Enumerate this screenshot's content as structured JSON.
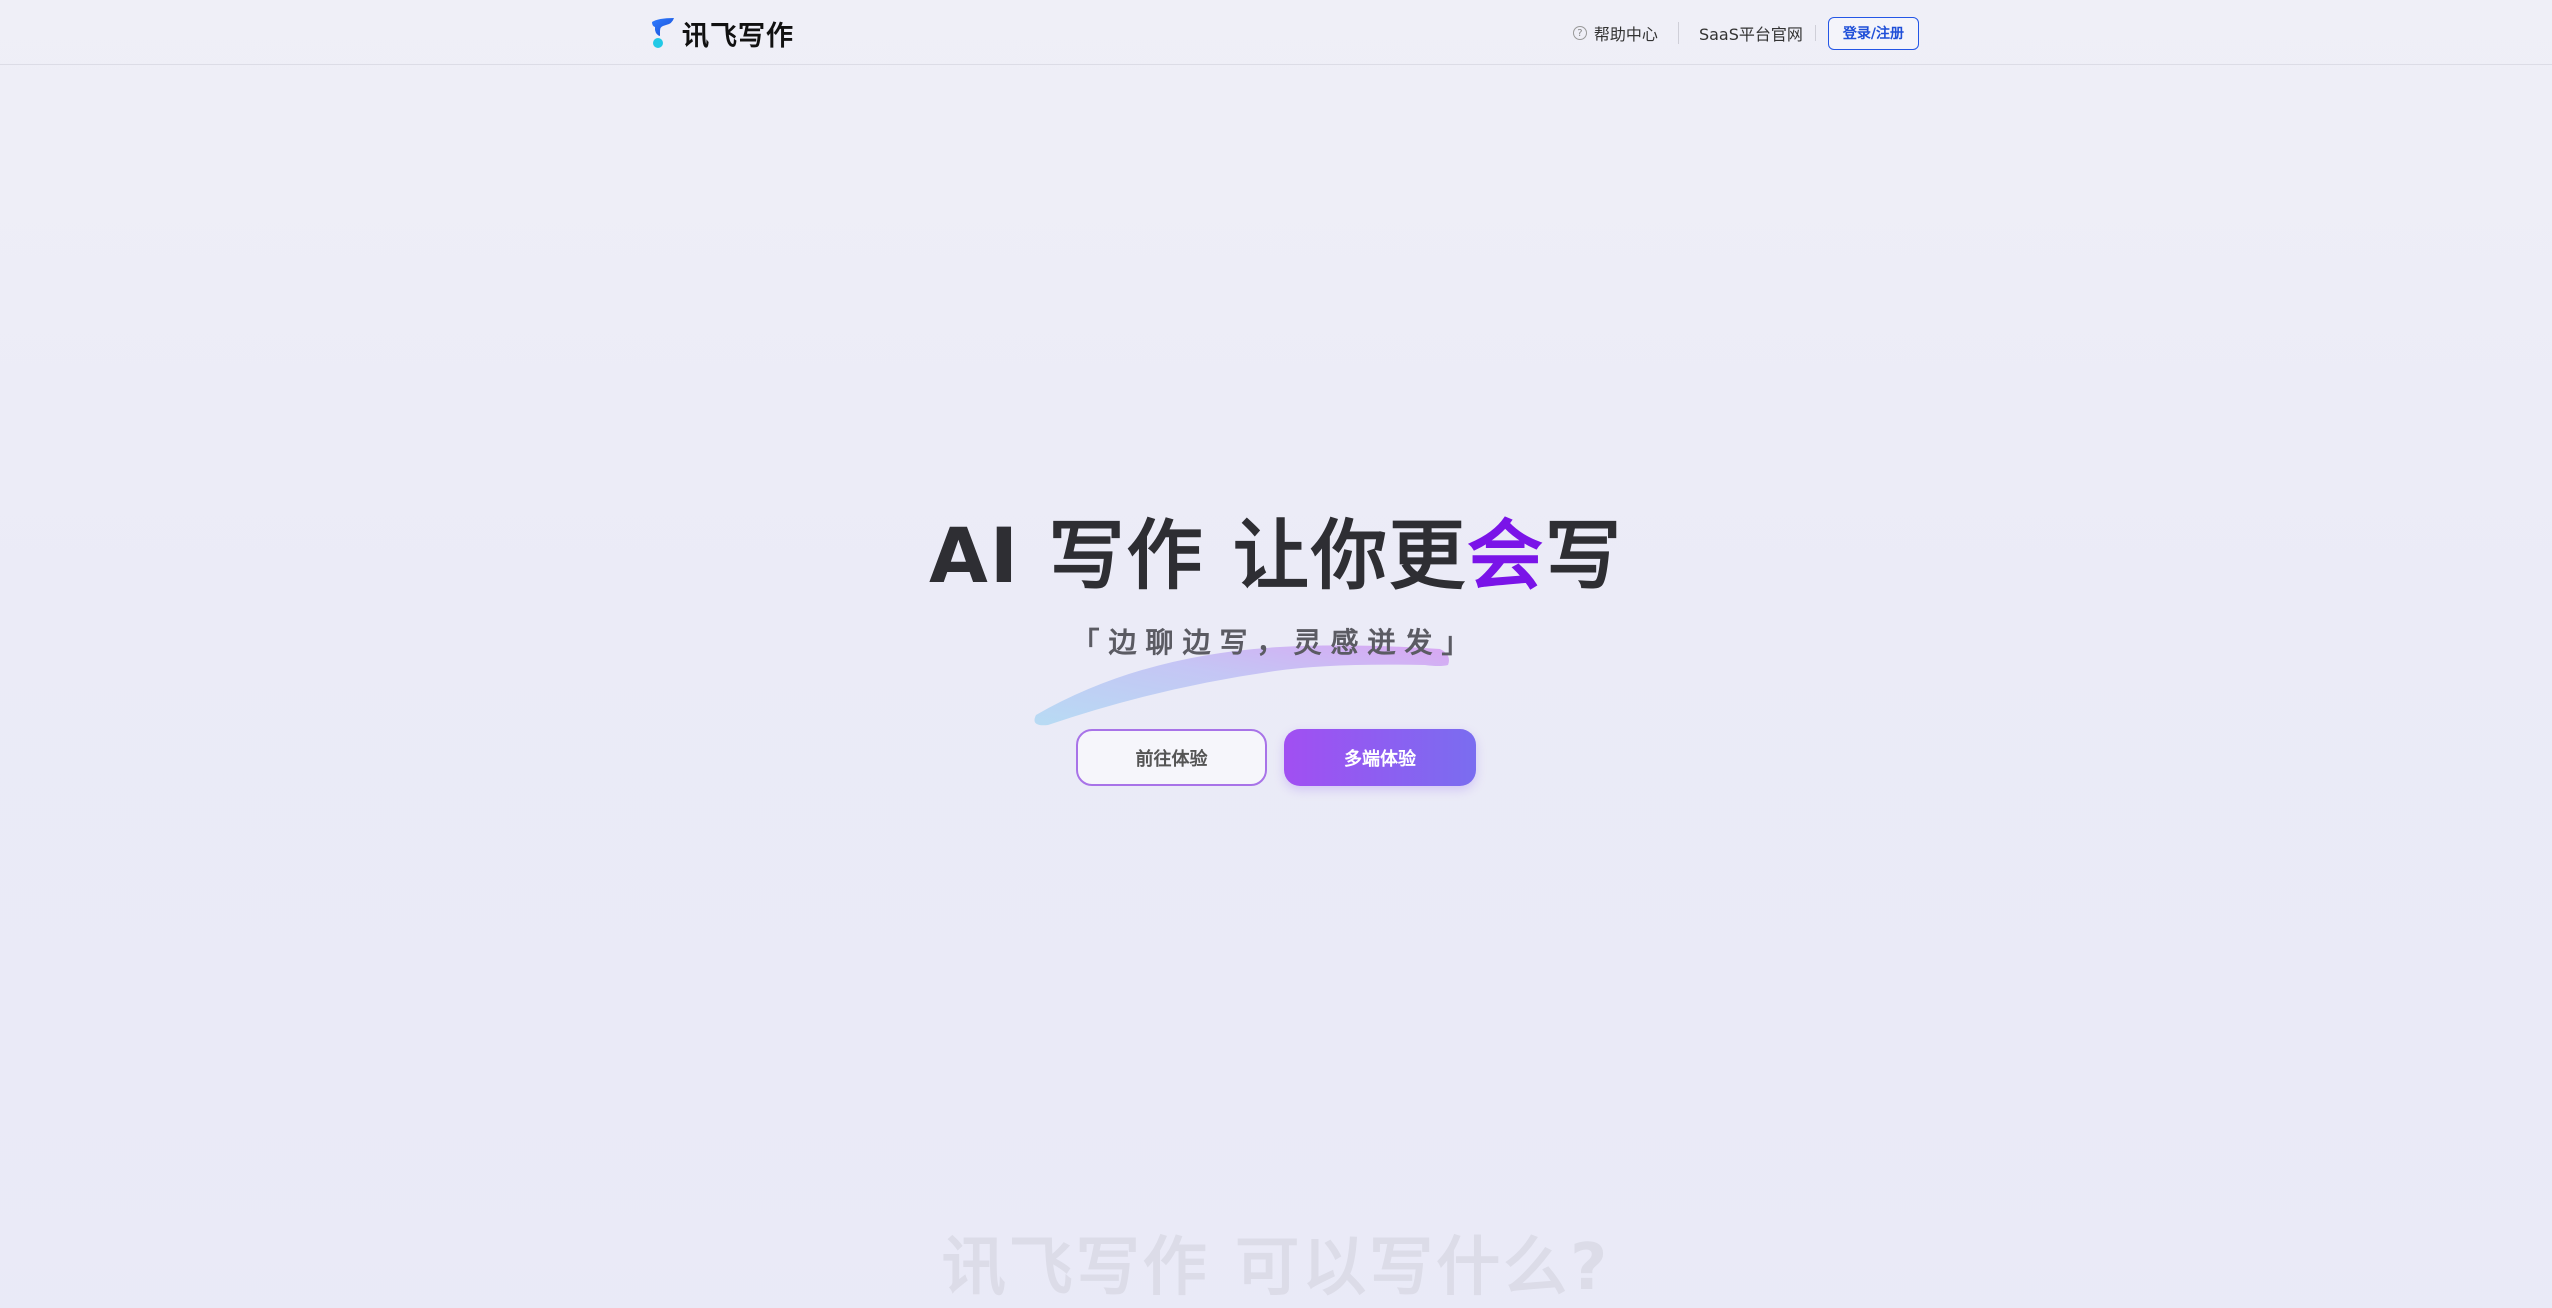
{
  "header": {
    "logo_text": "讯飞写作",
    "nav": {
      "help_icon_glyph": "?",
      "help_label": "帮助中心",
      "saas_label": "SaaS平台官网",
      "login_label": "登录/注册"
    }
  },
  "hero": {
    "title_prefix": "AI 写作 让你更",
    "title_accent": "会",
    "title_suffix": "写",
    "subtitle": "「边聊边写，灵感迸发」",
    "btn_try_label": "前往体验",
    "btn_multi_label": "多端体验"
  },
  "next_section": {
    "heading": "讯飞写作 可以写什么?"
  },
  "colors": {
    "accent_purple": "#7a14e8",
    "login_blue": "#1f4fd8",
    "button_gradient_start": "#a14ff2",
    "button_gradient_end": "#7a6df0"
  },
  "icons": {
    "logo": "xunfei-logo-icon",
    "help": "help-circle-icon"
  }
}
